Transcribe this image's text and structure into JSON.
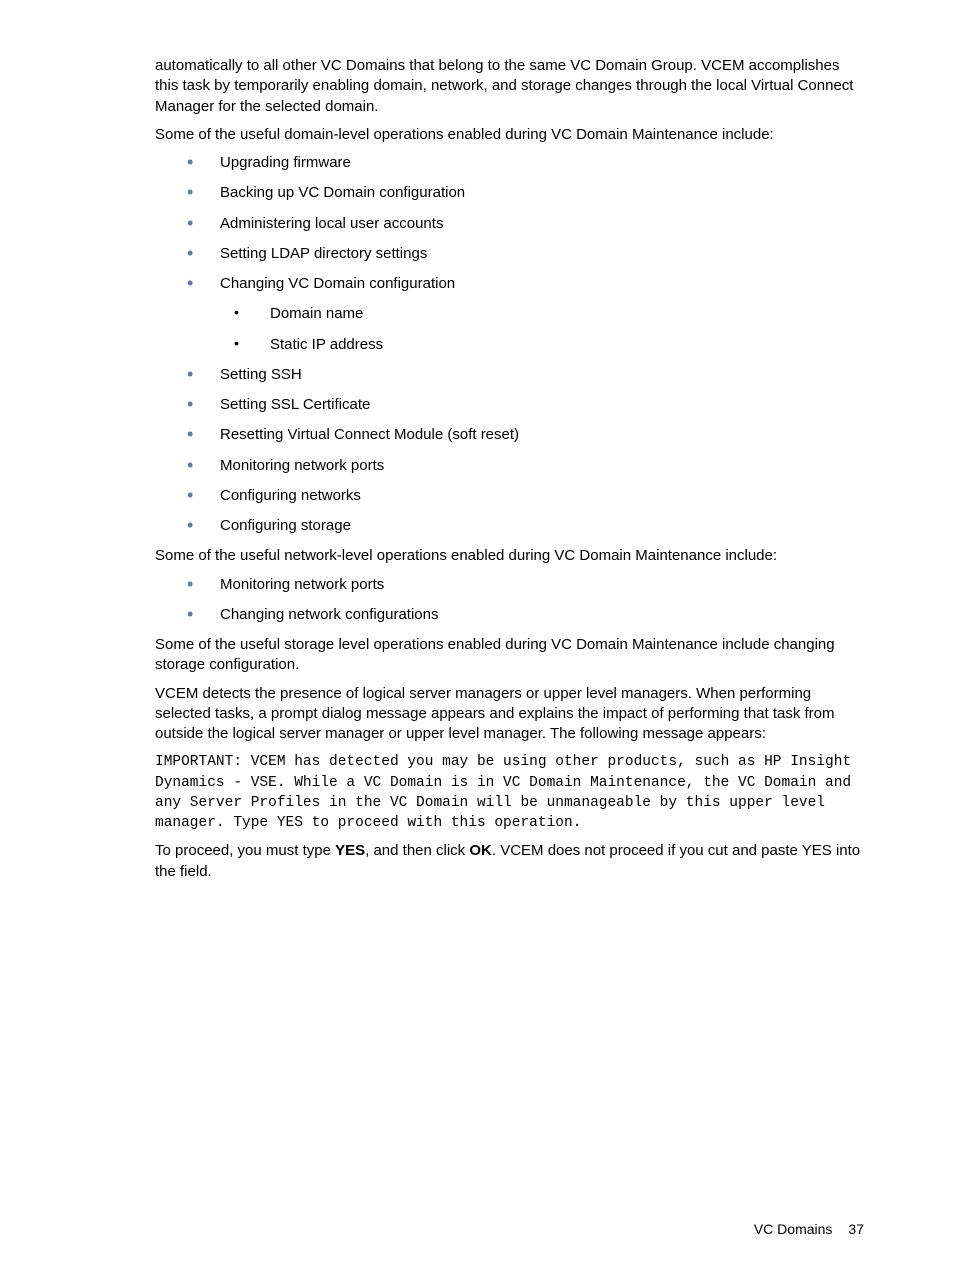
{
  "para1": "automatically to all other VC Domains that belong to the same VC Domain Group. VCEM accomplishes this task by temporarily enabling domain, network, and storage changes through the local Virtual Connect Manager for the selected domain.",
  "para2": "Some of the useful domain-level operations enabled during VC Domain Maintenance include:",
  "list1": [
    "Upgrading firmware",
    "Backing up VC Domain configuration",
    "Administering local user accounts",
    "Setting LDAP directory settings",
    "Changing VC Domain configuration",
    "Setting SSH",
    "Setting SSL Certificate",
    "Resetting Virtual Connect Module (soft reset)",
    "Monitoring network ports",
    "Configuring networks",
    "Configuring storage"
  ],
  "sublist1": [
    "Domain name",
    "Static IP address"
  ],
  "para3": "Some of the useful network-level operations enabled during VC Domain Maintenance include:",
  "list2": [
    "Monitoring network ports",
    "Changing network configurations"
  ],
  "para4": "Some of the useful storage level operations enabled during VC Domain Maintenance include changing storage configuration.",
  "para5": "VCEM detects the presence of logical server managers or upper level managers. When performing selected tasks, a prompt dialog message appears and explains the impact of performing that task from outside the logical server manager or upper level manager. The following message appears:",
  "mono1": "IMPORTANT: VCEM has detected you may be using other products, such as HP Insight Dynamics - VSE. While a VC Domain is in VC Domain Maintenance, the VC Domain and any Server Profiles in the VC Domain will be unmanageable by this upper level manager. Type YES to proceed with this operation.",
  "para6_pre": "To proceed, you must type ",
  "para6_b1": "YES",
  "para6_mid": ", and then click ",
  "para6_b2": "OK",
  "para6_post": ". VCEM does not proceed if you cut and paste YES into the field.",
  "footer_label": "VC Domains",
  "footer_page": "37"
}
